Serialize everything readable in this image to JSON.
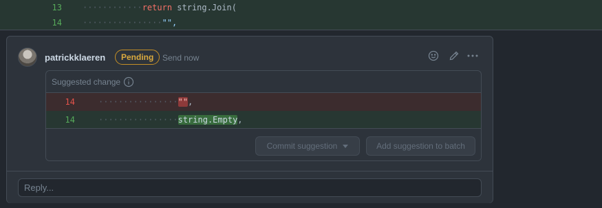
{
  "diff": {
    "lines": [
      {
        "num": "13",
        "indent": "············",
        "keyword": "return",
        "rest": " string.Join("
      },
      {
        "num": "14",
        "indent": "················",
        "keyword": "",
        "rest": "\"\","
      }
    ]
  },
  "comment": {
    "author": "patrickklaeren",
    "status_badge": "Pending",
    "send_now": "Send now",
    "icons": [
      "smiley-icon",
      "pencil-icon",
      "kebab-menu-icon"
    ]
  },
  "suggestion": {
    "title": "Suggested change",
    "deleted": {
      "num": "14",
      "indent": "················",
      "highlight": "\"\"",
      "rest": ","
    },
    "added": {
      "num": "14",
      "indent": "················",
      "highlight": "string.Empty",
      "rest": ","
    },
    "commit_button": "Commit suggestion",
    "batch_button": "Add suggestion to batch"
  },
  "reply": {
    "placeholder": "Reply..."
  },
  "colors": {
    "background": "#22272e",
    "card": "#2d333b",
    "added_line": "#273732",
    "deleted_line": "#3c2c2e",
    "pending": "#c69026"
  }
}
